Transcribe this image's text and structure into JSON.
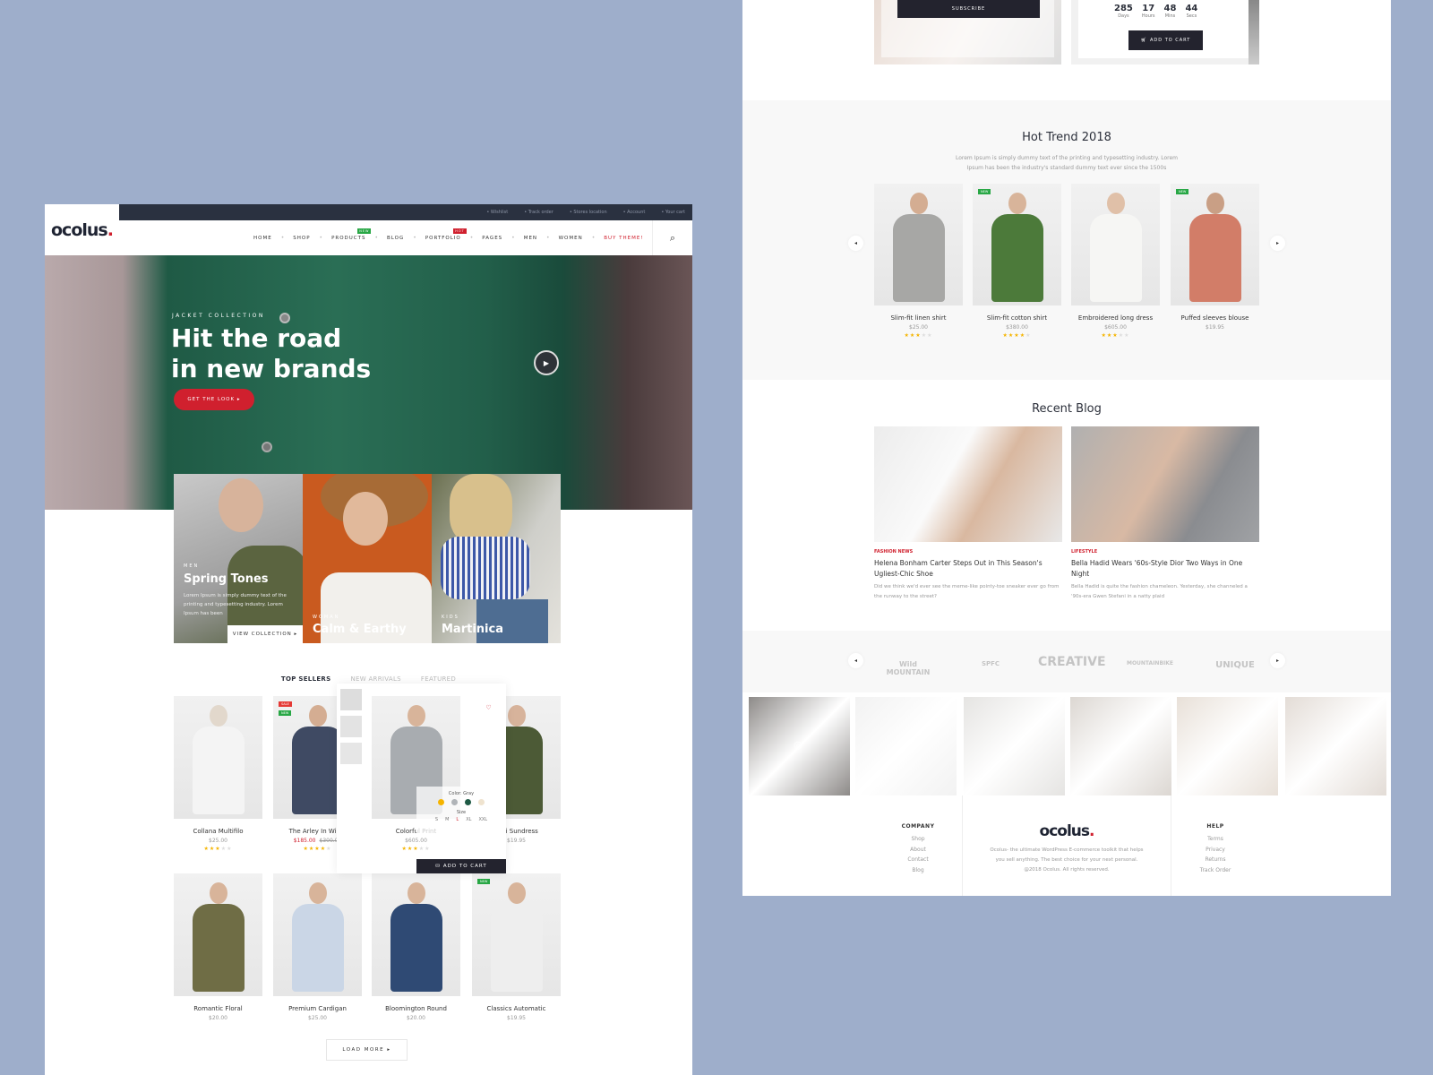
{
  "brand": {
    "name": "ocolus",
    "dot": ".",
    "accent": "#d0202e",
    "dark": "#23232e"
  },
  "topbar": {
    "links": [
      {
        "icon": "heart-icon",
        "label": "Wishlist"
      },
      {
        "icon": "map-pin-icon",
        "label": "Track order"
      },
      {
        "icon": "store-icon",
        "label": "Stores location"
      },
      {
        "icon": "user-icon",
        "label": "Account"
      },
      {
        "icon": "bag-icon",
        "label": "Your cart"
      }
    ]
  },
  "nav": {
    "items": [
      {
        "label": "HOME"
      },
      {
        "label": "SHOP"
      },
      {
        "label": "PRODUCTS",
        "badge": "NEW"
      },
      {
        "label": "BLOG"
      },
      {
        "label": "PORTFOLIO",
        "badge": "HOT"
      },
      {
        "label": "PAGES"
      },
      {
        "label": "MEN"
      },
      {
        "label": "WOMEN"
      },
      {
        "label": "BUY THEME!",
        "highlight": true
      }
    ],
    "search_icon": "search-icon"
  },
  "hero": {
    "kicker": "JACKET COLLECTION",
    "title_line1": "Hit the road",
    "title_line2": "in new brands",
    "cta": "GET THE LOOK ▸"
  },
  "collections": [
    {
      "kicker": "MEN",
      "title": "Spring Tones",
      "desc": "Lorem Ipsum is simply dummy text of the printing and typesetting industry. Lorem Ipsum has been",
      "link": "VIEW COLLECTION ▸"
    },
    {
      "kicker": "WOMAN",
      "title": "Calm & Earthy"
    },
    {
      "kicker": "KIDS",
      "title": "Martinica"
    }
  ],
  "product_tabs": [
    {
      "label": "TOP SELLERS",
      "active": true
    },
    {
      "label": "NEW ARRIVALS"
    },
    {
      "label": "FEATURED"
    }
  ],
  "products": [
    {
      "name": "Collana Multifilo",
      "price": "$25.00",
      "rating": 3
    },
    {
      "name": "The Arley In Wildfi",
      "price": "$185.00",
      "old_price": "$300.00",
      "rating": 4,
      "tags": [
        "SALE",
        "NEW"
      ]
    },
    {
      "name": "Colorful Print",
      "price": "$605.00",
      "rating": 3,
      "hover": true
    },
    {
      "name": "Mini Sundress",
      "price": "$19.95",
      "tags": [
        "NEW"
      ]
    },
    {
      "name": "Romantic Floral",
      "price": "$20.00"
    },
    {
      "name": "Premium Cardigan",
      "price": "$25.00"
    },
    {
      "name": "Bloomington Round",
      "price": "$20.00"
    },
    {
      "name": "Classics Automatic",
      "price": "$19.95",
      "tags": [
        "NEW"
      ]
    }
  ],
  "quick_view": {
    "color_label": "Color: Gray",
    "colors": [
      "#f5b400",
      "#b0b4b8",
      "#1f5a45",
      "#efe3cf"
    ],
    "size_label": "Size",
    "sizes": [
      "S",
      "M",
      "L",
      "XL",
      "XXL"
    ],
    "selected_size": "L",
    "add_to_cart": "ADD TO CART"
  },
  "load_more": "LOAD MORE ▸",
  "promo": {
    "subscribe": "SUBSCRIBE",
    "countdown": [
      {
        "value": "285",
        "unit": "Days"
      },
      {
        "value": "17",
        "unit": "Hours"
      },
      {
        "value": "48",
        "unit": "Mins"
      },
      {
        "value": "44",
        "unit": "Secs"
      }
    ],
    "add_to_cart": "ADD TO CART"
  },
  "hot_trend": {
    "title": "Hot Trend 2018",
    "subtitle_line1": "Lorem Ipsum is simply dummy text of the printing and typesetting industry. Lorem",
    "subtitle_line2": "Ipsum has been the industry's standard dummy text ever since the 1500s",
    "products": [
      {
        "name": "Slim-fit linen shirt",
        "price": "$25.00",
        "rating": 3
      },
      {
        "name": "Slim-fit cotton shirt",
        "price": "$380.00",
        "rating": 4,
        "tags": [
          "NEW"
        ]
      },
      {
        "name": "Embroidered long dress",
        "price": "$605.00",
        "rating": 3
      },
      {
        "name": "Puffed sleeves blouse",
        "price": "$19.95",
        "tags": [
          "NEW"
        ]
      }
    ]
  },
  "recent_blog": {
    "title": "Recent Blog",
    "posts": [
      {
        "category": "FASHION NEWS",
        "title": "Helena Bonham Carter Steps Out in This Season's Ugliest-Chic Shoe",
        "excerpt": "Did we think we'd ever see the meme-like pointy-toe sneaker ever go from the runway to the street?"
      },
      {
        "category": "LIFESTYLE",
        "title": "Bella Hadid Wears '60s-Style Dior Two Ways in One Night",
        "excerpt": "Bella Hadid is quite the fashion chameleon. Yesterday, she channeled a '90s-era Gwen Stefani in a natty plaid"
      }
    ]
  },
  "brands": [
    "Wild MOUNTAIN",
    "SPFC",
    "CREATIVE",
    "MOUNTAINBIKE",
    "UNIQUE"
  ],
  "instagram": {
    "icon": "instagram-icon"
  },
  "footer": {
    "company": {
      "title": "COMPANY",
      "links": [
        "Shop",
        "About",
        "Contact",
        "Blog"
      ]
    },
    "about_line1": "Ocolus- the ultimate WordPress E-commerce toolkit that helps",
    "about_line2": "you sell anything. The best choice for your next personal.",
    "copyright": "@2018 Ocolus. All rights reserved.",
    "help": {
      "title": "HELP",
      "links": [
        "Terms",
        "Privacy",
        "Returns",
        "Track Order"
      ]
    }
  }
}
